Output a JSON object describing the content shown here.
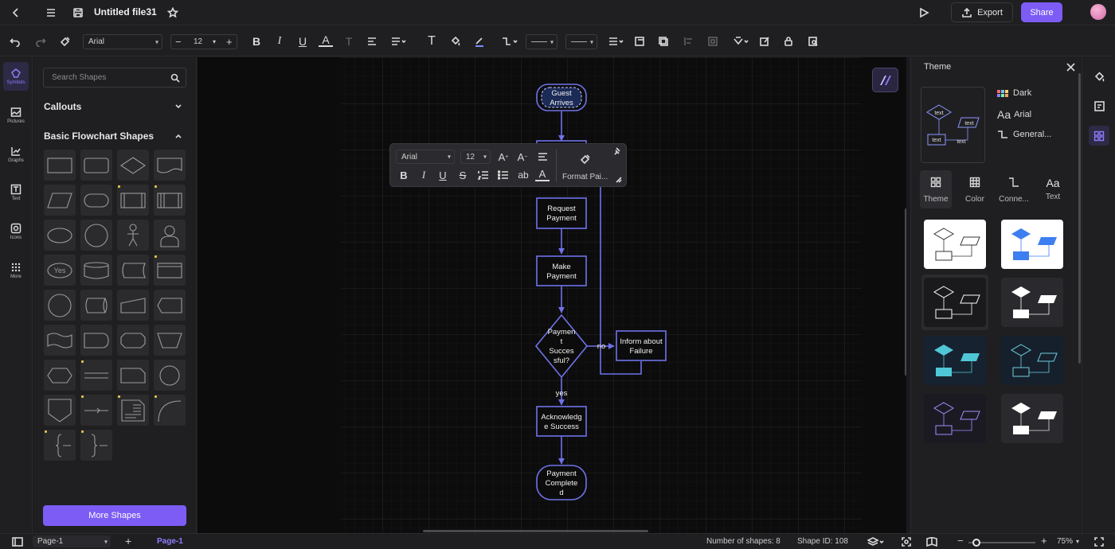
{
  "header": {
    "file_title": "Untitled file31",
    "export_label": "Export",
    "share_label": "Share",
    "accent": "#7c5cf5"
  },
  "toolbar": {
    "font_family": "Arial",
    "font_size": "12"
  },
  "rail": {
    "items": [
      {
        "label": "Symbols",
        "icon": "symbols-icon"
      },
      {
        "label": "Pictures",
        "icon": "pictures-icon"
      },
      {
        "label": "Graphs",
        "icon": "graphs-icon"
      },
      {
        "label": "Text",
        "icon": "text-icon"
      },
      {
        "label": "Icons",
        "icon": "icons-icon"
      },
      {
        "label": "More",
        "icon": "more-icon"
      }
    ]
  },
  "shapes_panel": {
    "search_placeholder": "Search Shapes",
    "callouts_title": "Callouts",
    "basic_title": "Basic Flowchart Shapes",
    "more_shapes_label": "More Shapes",
    "yes_tile_label": "Yes"
  },
  "floating_toolbar": {
    "font_family": "Arial",
    "font_size": "12",
    "format_painter_label": "Format Pai..."
  },
  "flowchart": {
    "nodes": {
      "guest_line1": "Guest",
      "guest_line2": "Arrives",
      "request_line1": "Request",
      "request_line2": "Payment",
      "make_line1": "Make",
      "make_line2": "Payment",
      "decision_line1": "Paymen",
      "decision_line2": "t",
      "decision_line3": "Succes",
      "decision_line4": "sful?",
      "inform_line1": "Inform about",
      "inform_line2": "Failure",
      "ack_line1": "Acknowledg",
      "ack_line2": "e Success",
      "complete_line1": "Payment",
      "complete_line2": "Complete",
      "complete_line3": "d"
    },
    "edge_yes": "yes",
    "edge_no": "no",
    "stroke_color": "#6f73e8"
  },
  "theme_panel": {
    "title": "Theme",
    "summary": {
      "theme": "Dark",
      "font": "Arial",
      "connector": "General..."
    },
    "preview_text": "text",
    "tabs": [
      "Theme",
      "Color",
      "Conne...",
      "Text"
    ]
  },
  "status": {
    "page_select": "Page-1",
    "page_tab": "Page-1",
    "shape_count": "Number of shapes: 8",
    "shape_id": "Shape ID: 108",
    "zoom": "75%"
  }
}
